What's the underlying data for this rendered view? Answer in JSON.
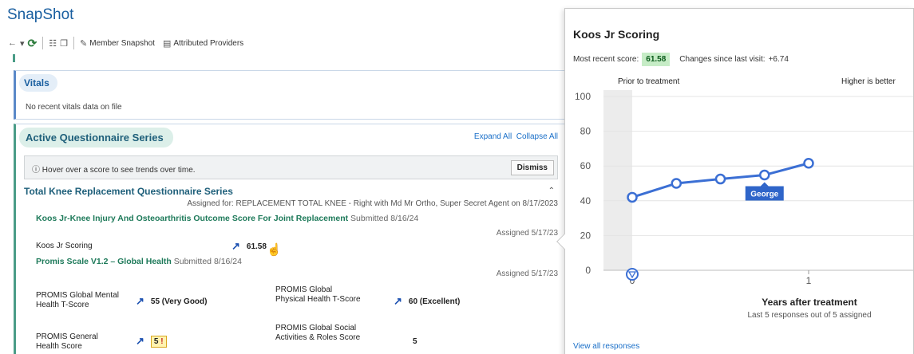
{
  "app": {
    "title": "SnapShot"
  },
  "toolbar": {
    "member_snapshot": "Member Snapshot",
    "attributed_providers": "Attributed Providers"
  },
  "vitals": {
    "title": "Vitals",
    "message": "No recent vitals data on file"
  },
  "aqs": {
    "title": "Active Questionnaire Series",
    "expand_all": "Expand All",
    "collapse_all": "Collapse All",
    "hover_info": "Hover over a score to see trends over time.",
    "dismiss": "Dismiss",
    "series_title": "Total Knee Replacement Questionnaire Series",
    "assigned_for": "Assigned for: REPLACEMENT TOTAL KNEE - Right with Md Mr Ortho, Super Secret Agent on 8/17/2023",
    "koos_title": "Koos Jr-Knee Injury And Osteoarthritis Outcome Score For Joint Replacement",
    "koos_submitted": "Submitted 8/16/24",
    "koos_assigned": "Assigned 5/17/23",
    "koos_label": "Koos Jr Scoring",
    "koos_value": "61.58",
    "promis_title": "Promis Scale V1.2 – Global Health",
    "promis_submitted": "Submitted 8/16/24",
    "promis_assigned": "Assigned 5/17/23",
    "mental_label": "PROMIS Global Mental Health T-Score",
    "mental_value": "55 (Very Good)",
    "physical_label": "PROMIS Global Physical Health T-Score",
    "physical_value": "60 (Excellent)",
    "general_label": "PROMIS General Health Score",
    "general_value": "5",
    "general_flag": "!",
    "social_label": "PROMIS Global Social Activities & Roles Score",
    "social_value": "5"
  },
  "panel": {
    "title": "Koos Jr Scoring",
    "recent_label": "Most recent score:",
    "recent_value": "61.58",
    "changes_label": "Changes since last visit:",
    "changes_value": "+6.74",
    "view_all": "View all responses"
  },
  "chart_data": {
    "type": "line",
    "x": [
      0,
      0.25,
      0.5,
      0.75,
      1
    ],
    "series": [
      {
        "values": [
          42,
          50,
          52.5,
          54.8,
          61.58
        ]
      }
    ],
    "xlabel": "Years after treatment",
    "subtitle": "Last 5 responses out of 5 assigned",
    "yticks": [
      "0",
      "20",
      "40",
      "60",
      "80",
      "100"
    ],
    "xticks": [
      "0",
      "1"
    ],
    "ylim": [
      0,
      100
    ],
    "annotations": [
      "Prior to treatment",
      "Higher is better"
    ],
    "tooltip": "George",
    "line_color": "#3b6fd4"
  }
}
